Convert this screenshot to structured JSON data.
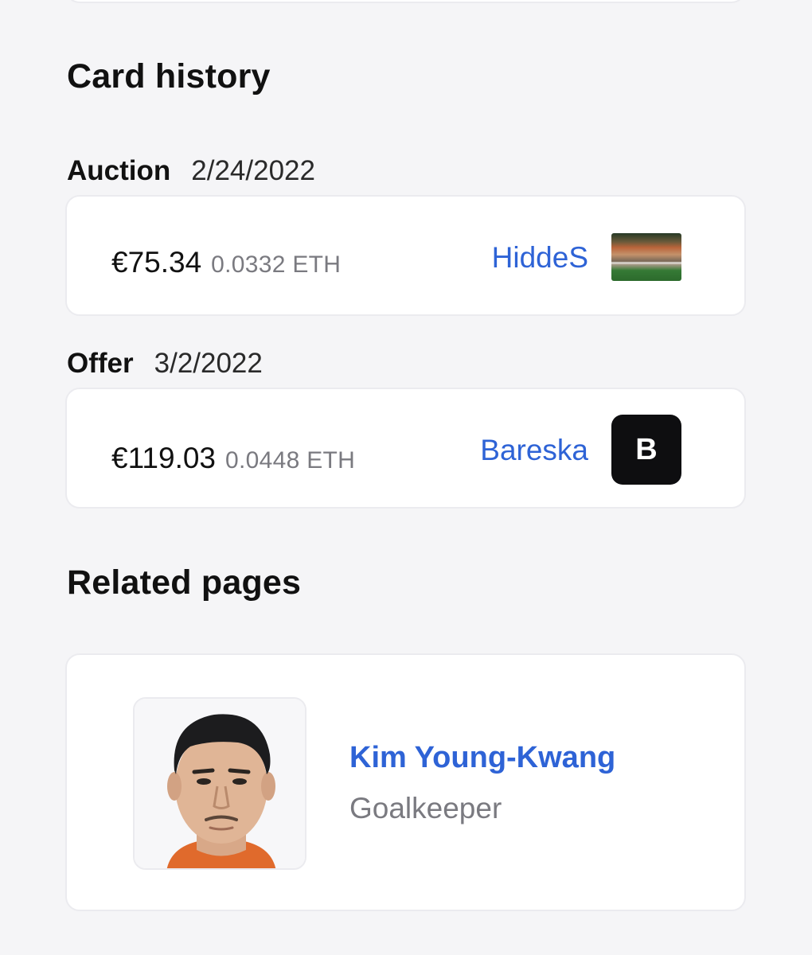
{
  "card_history": {
    "title": "Card history",
    "entries": [
      {
        "kind": "Auction",
        "date": "2/24/2022",
        "price": "€75.34",
        "eth": "0.0332 ETH",
        "user": "HiddeS",
        "avatar_type": "photo-thumbnail"
      },
      {
        "kind": "Offer",
        "date": "3/2/2022",
        "price": "€119.03",
        "eth": "0.0448 ETH",
        "user": "Bareska",
        "avatar_letter": "B"
      }
    ]
  },
  "related_pages": {
    "title": "Related pages",
    "player": {
      "name": "Kim Young-Kwang",
      "position": "Goalkeeper"
    }
  },
  "colors": {
    "link": "#2e63d6",
    "background": "#f5f5f7",
    "card": "#ffffff",
    "muted": "#7a7a80",
    "avatar_dark": "#0e0e10"
  }
}
